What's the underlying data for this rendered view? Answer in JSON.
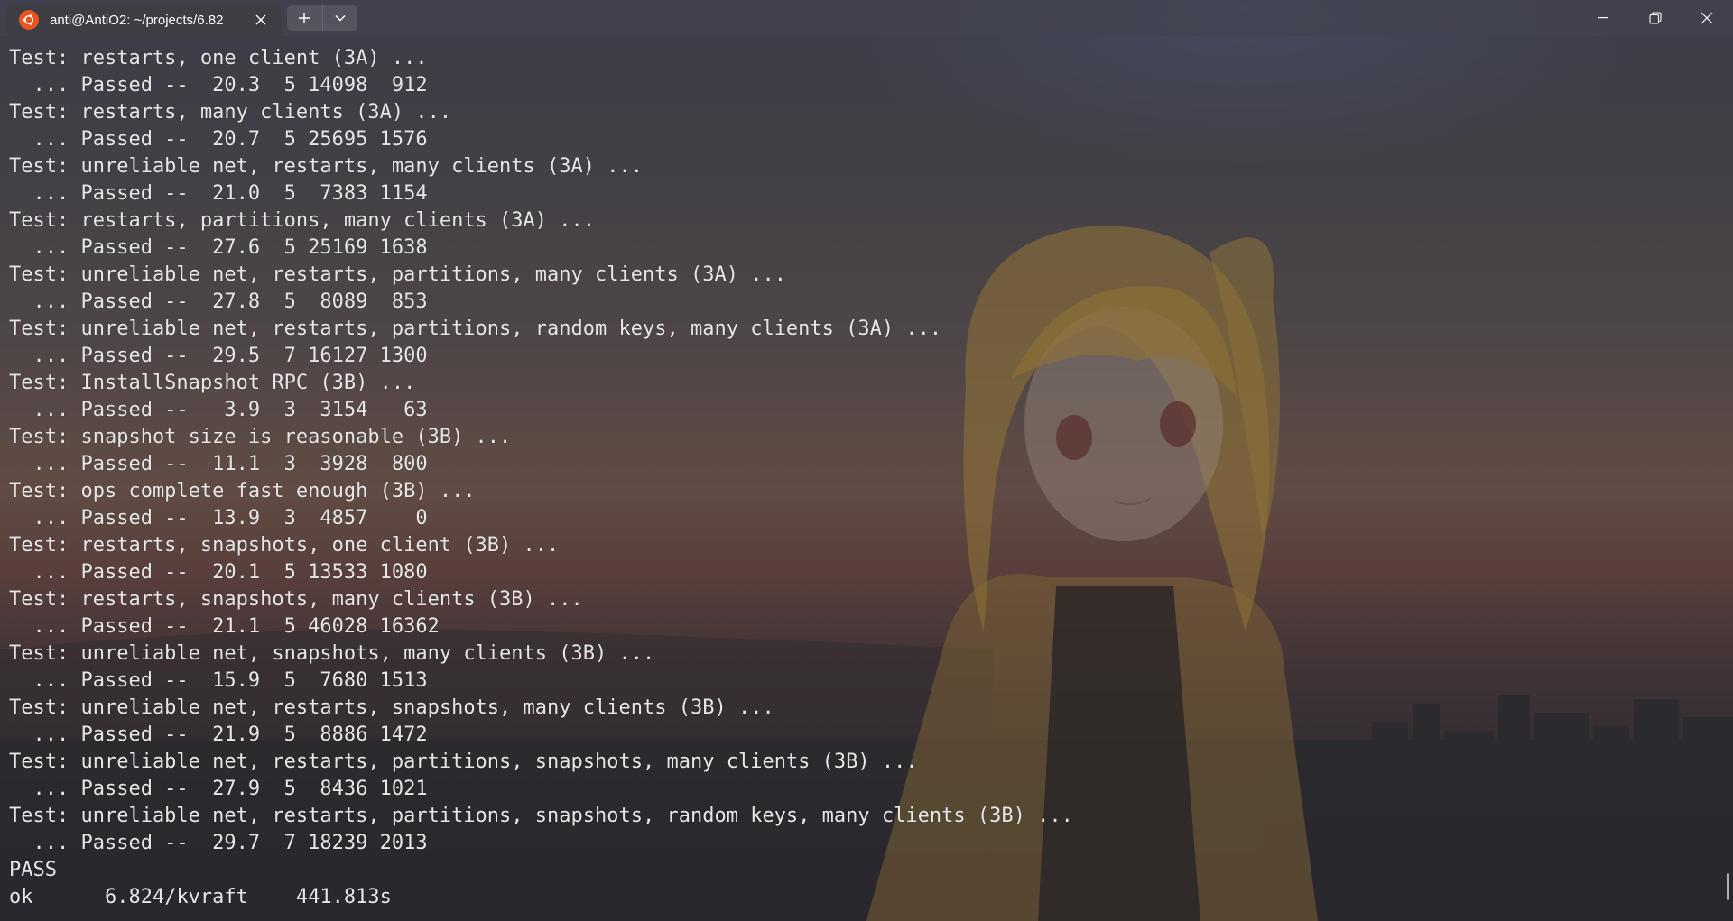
{
  "window": {
    "tab_title": "anti@AntiO2: ~/projects/6.82",
    "icons": {
      "app": "ubuntu-icon",
      "close_tab": "close-icon",
      "new_tab": "plus-icon",
      "tab_menu": "chevron-down-icon",
      "minimize": "minimize-icon",
      "maximize": "restore-icon",
      "close": "close-icon"
    }
  },
  "terminal": {
    "lines": [
      "Test: restarts, one client (3A) ...",
      "  ... Passed --  20.3  5 14098  912",
      "Test: restarts, many clients (3A) ...",
      "  ... Passed --  20.7  5 25695 1576",
      "Test: unreliable net, restarts, many clients (3A) ...",
      "  ... Passed --  21.0  5  7383 1154",
      "Test: restarts, partitions, many clients (3A) ...",
      "  ... Passed --  27.6  5 25169 1638",
      "Test: unreliable net, restarts, partitions, many clients (3A) ...",
      "  ... Passed --  27.8  5  8089  853",
      "Test: unreliable net, restarts, partitions, random keys, many clients (3A) ...",
      "  ... Passed --  29.5  7 16127 1300",
      "Test: InstallSnapshot RPC (3B) ...",
      "  ... Passed --   3.9  3  3154   63",
      "Test: snapshot size is reasonable (3B) ...",
      "  ... Passed --  11.1  3  3928  800",
      "Test: ops complete fast enough (3B) ...",
      "  ... Passed --  13.9  3  4857    0",
      "Test: restarts, snapshots, one client (3B) ...",
      "  ... Passed --  20.1  5 13533 1080",
      "Test: restarts, snapshots, many clients (3B) ...",
      "  ... Passed --  21.1  5 46028 16362",
      "Test: unreliable net, snapshots, many clients (3B) ...",
      "  ... Passed --  15.9  5  7680 1513",
      "Test: unreliable net, restarts, snapshots, many clients (3B) ...",
      "  ... Passed --  21.9  5  8886 1472",
      "Test: unreliable net, restarts, partitions, snapshots, many clients (3B) ...",
      "  ... Passed --  27.9  5  8436 1021",
      "Test: unreliable net, restarts, partitions, snapshots, random keys, many clients (3B) ...",
      "  ... Passed --  29.7  7 18239 2013",
      "PASS",
      "ok  \t6.824/kvraft\t441.813s"
    ]
  },
  "colors": {
    "text": "#e6e6e6",
    "ubuntu_orange": "#e95420",
    "titlebar": "#3e3f4a"
  }
}
